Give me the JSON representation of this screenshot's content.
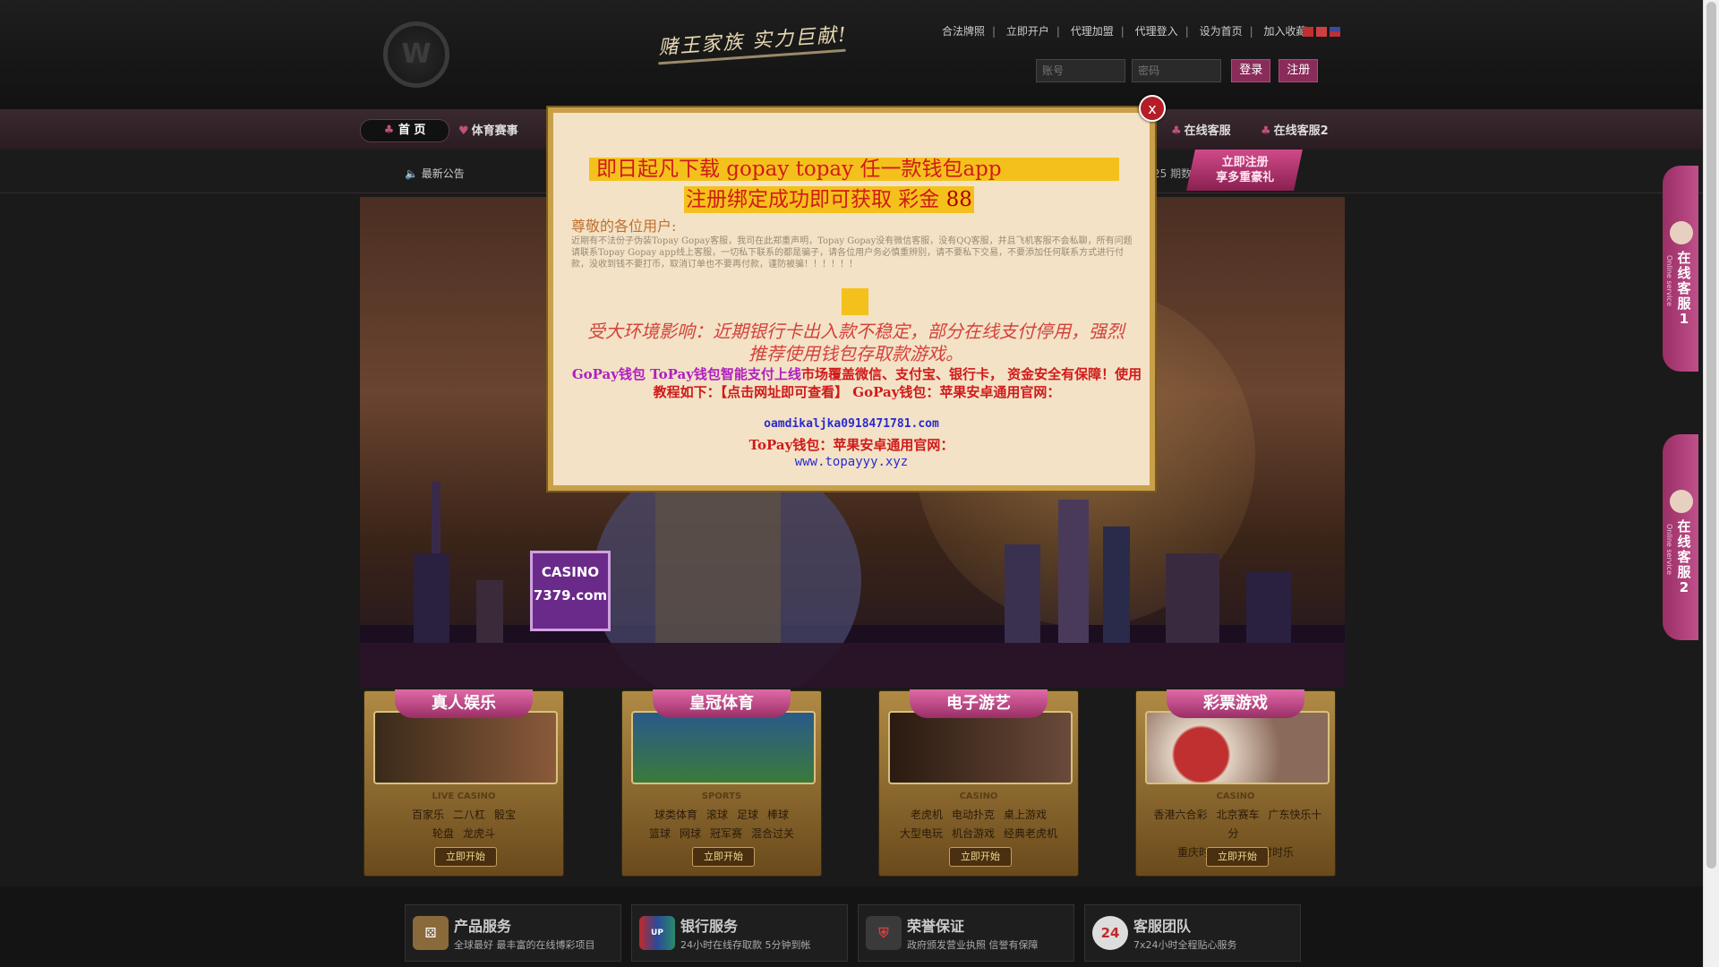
{
  "header": {
    "slogan": "赌王家族  实力巨献!",
    "links": [
      "合法牌照",
      "立即开户",
      "代理加盟",
      "代理登入",
      "设为首页",
      "加入收藏"
    ],
    "username_placeholder": "账号",
    "password_placeholder": "密码",
    "login_label": "登录",
    "register_label": "注册"
  },
  "nav": {
    "home": "首 页",
    "sports": "体育赛事",
    "service1": "在线客服",
    "service2": "在线客服2"
  },
  "subnav": {
    "notice_label": "最新公告",
    "period": "25 期数",
    "register_line1": "立即注册",
    "register_line2": "享多重豪礼"
  },
  "hero": {
    "sign_line1": "CASINO",
    "sign_line2": "7379.com"
  },
  "games": [
    {
      "title": "真人娱乐",
      "category": "LIVE CASINO",
      "items_row1": [
        "百家乐",
        "二八杠",
        "骰宝"
      ],
      "items_row2": [
        "轮盘",
        "龙虎斗"
      ],
      "button": "立即开始"
    },
    {
      "title": "皇冠体育",
      "category": "SPORTS",
      "items_row1": [
        "球类体育",
        "滚球",
        "足球",
        "棒球"
      ],
      "items_row2": [
        "篮球",
        "网球",
        "冠军赛",
        "混合过关"
      ],
      "button": "立即开始"
    },
    {
      "title": "电子游艺",
      "category": "CASINO",
      "items_row1": [
        "老虎机",
        "电动扑克",
        "桌上游戏"
      ],
      "items_row2": [
        "大型电玩",
        "机台游戏",
        "经典老虎机"
      ],
      "button": "立即开始"
    },
    {
      "title": "彩票游戏",
      "category": "CASINO",
      "items_row1": [
        "香港六合彩",
        "北京赛车",
        "广东快乐十分"
      ],
      "items_row2": [
        "重庆时时彩",
        "上海时时乐"
      ],
      "button": "立即开始"
    }
  ],
  "services": [
    {
      "title": "产品服务",
      "sub": "全球最好 最丰富的在线博彩项目"
    },
    {
      "title": "银行服务",
      "sub": "24小时在线存取款 5分钟到帐"
    },
    {
      "title": "荣誉保证",
      "sub": "政府颁发营业执照 信誉有保障"
    },
    {
      "title": "客服团队",
      "sub": "7x24小时全程贴心服务"
    }
  ],
  "sidetabs": [
    {
      "label": "在线客服1",
      "sub": "Online service"
    },
    {
      "label": "在线客服2",
      "sub": "Online service"
    }
  ],
  "popup": {
    "close": "x",
    "headline1": "即日起凡下载 gopay    topay   任一款钱包app",
    "headline2_text": "注册绑定成功即可获取 彩金 ",
    "headline2_amount": "88",
    "greeting": "尊敬的各位用户:",
    "notice": "近期有不法份子伪装Topay  Gopay客服，我司在此郑重声明，Topay    Gopay没有微信客服，没有QQ客服，并且飞机客服不会私聊，所有问题请联系Topay  Gopay  app线上客服，一切私下联系的都是骗子，请各位用户务必慎重辨别，请不要私下交易，不要添加任何联系方式进行付款，没收到钱不要打币，取消订单也不要再付款，谨防被骗！！！！！！",
    "warning": "受大环境影响：近期银行卡出入款不稳定，部分在线支付停用，强烈推荐使用钱包存取款游戏。",
    "gopay_mag": "GoPay钱包 ToPay钱包智能支付上线",
    "gopay_rest": "市场覆盖微信、支付宝、银行卡， 资金安全有保障！使用教程如下：【点击网址即可查看】 GoPay钱包：苹果安卓通用官网：",
    "url1": "oamdikaljka0918471781.com",
    "topay_line": "ToPay钱包：苹果安卓通用官网：",
    "url2": "www.topayyy.xyz"
  }
}
